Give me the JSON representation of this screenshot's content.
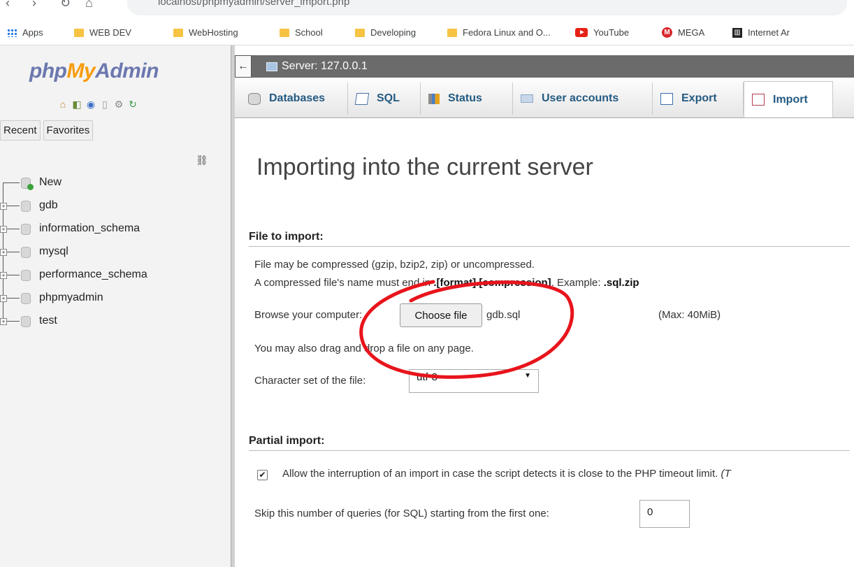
{
  "browser": {
    "url": "localhost/phpmyadmin/server_import.php",
    "bookmarks": [
      {
        "label": "Apps",
        "icon": "apps-grid-icon"
      },
      {
        "label": "WEB DEV",
        "icon": "folder-icon"
      },
      {
        "label": "WebHosting",
        "icon": "folder-icon"
      },
      {
        "label": "School",
        "icon": "folder-icon"
      },
      {
        "label": "Developing",
        "icon": "folder-icon"
      },
      {
        "label": "Fedora Linux and O...",
        "icon": "folder-icon"
      },
      {
        "label": "YouTube",
        "icon": "youtube-icon"
      },
      {
        "label": "MEGA",
        "icon": "mega-icon"
      },
      {
        "label": "Internet Ar",
        "icon": "internet-archive-icon"
      }
    ]
  },
  "sidebar": {
    "logo": {
      "php": "php",
      "my": "My",
      "admin": "Admin"
    },
    "tabs": [
      "Recent",
      "Favorites"
    ],
    "tree": [
      {
        "label": "New",
        "type": "new"
      },
      {
        "label": "gdb",
        "type": "db"
      },
      {
        "label": "information_schema",
        "type": "db"
      },
      {
        "label": "mysql",
        "type": "db"
      },
      {
        "label": "performance_schema",
        "type": "db"
      },
      {
        "label": "phpmyadmin",
        "type": "db"
      },
      {
        "label": "test",
        "type": "db"
      }
    ]
  },
  "server_bar": {
    "label": "Server: 127.0.0.1"
  },
  "menu": {
    "tabs": [
      {
        "label": "Databases",
        "icon": "database-icon"
      },
      {
        "label": "SQL",
        "icon": "sql-icon"
      },
      {
        "label": "Status",
        "icon": "status-icon"
      },
      {
        "label": "User accounts",
        "icon": "user-accounts-icon"
      },
      {
        "label": "Export",
        "icon": "export-icon"
      },
      {
        "label": "Import",
        "icon": "import-icon",
        "active": true
      }
    ]
  },
  "main": {
    "title": "Importing into the current server",
    "file_section": {
      "heading": "File to import:",
      "compress_note": "File may be compressed (gzip, bzip2, zip) or uncompressed.",
      "name_note_prefix": "A compressed file's name must end in ",
      "name_note_format": ".[format].[compression]",
      "name_note_mid": ". Example: ",
      "name_note_example": ".sql.zip",
      "browse_label": "Browse your computer:",
      "choose_button": "Choose file",
      "file_name": "gdb.sql",
      "max_size": "(Max: 40MiB)",
      "drag_note": "You may also drag and drop a file on any page.",
      "charset_label": "Character set of the file:",
      "charset_value": "utf-8"
    },
    "partial_section": {
      "heading": "Partial import:",
      "interrupt_label": "Allow the interruption of an import in case the script detects it is close to the PHP timeout limit.",
      "interrupt_suffix": "(T",
      "interrupt_checked": true,
      "skip_label": "Skip this number of queries (for SQL) starting from the first one:",
      "skip_value": "0"
    }
  },
  "colors": {
    "annotation": "#e8141c",
    "tab_text": "#235a81",
    "server_bar": "#6b6b6b"
  }
}
